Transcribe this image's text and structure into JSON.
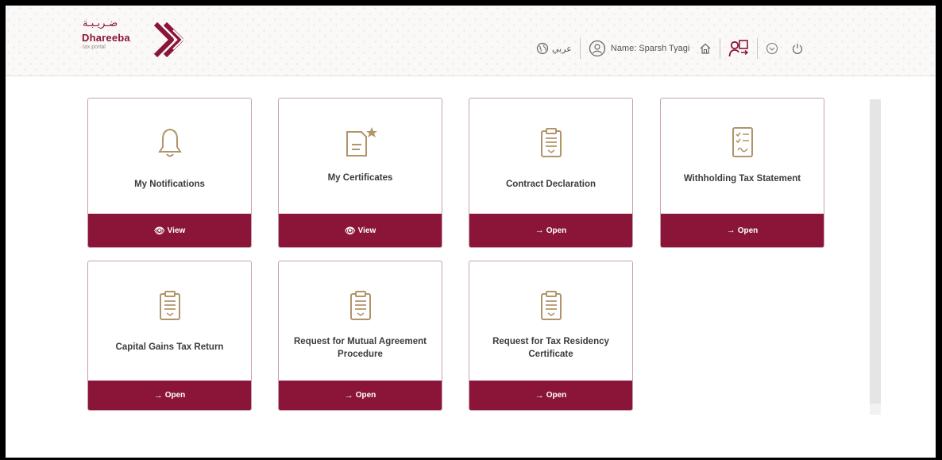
{
  "header": {
    "logo_arabic": "ضـريـبـة",
    "logo_brand": "Dhareeba",
    "logo_sub": "tax portal",
    "language_label": "عربي",
    "user_label": "Name: Sparsh Tyagi"
  },
  "cards": [
    {
      "title": "My Notifications",
      "action": "View",
      "icon": "bell-icon"
    },
    {
      "title": "My Certificates",
      "action": "View",
      "icon": "certificate-icon"
    },
    {
      "title": "Contract Declaration",
      "action": "Open",
      "icon": "clipboard-icon"
    },
    {
      "title": "Withholding Tax Statement",
      "action": "Open",
      "icon": "checklist-icon"
    },
    {
      "title": "Capital Gains Tax Return",
      "action": "Open",
      "icon": "clipboard-icon"
    },
    {
      "title": "Request for Mutual Agreement Procedure",
      "action": "Open",
      "icon": "clipboard-icon"
    },
    {
      "title": "Request for Tax Residency Certificate",
      "action": "Open",
      "icon": "clipboard-icon"
    }
  ],
  "colors": {
    "brand": "#8a1538",
    "icon": "#b0956a",
    "card_border": "#c9a0ad"
  }
}
